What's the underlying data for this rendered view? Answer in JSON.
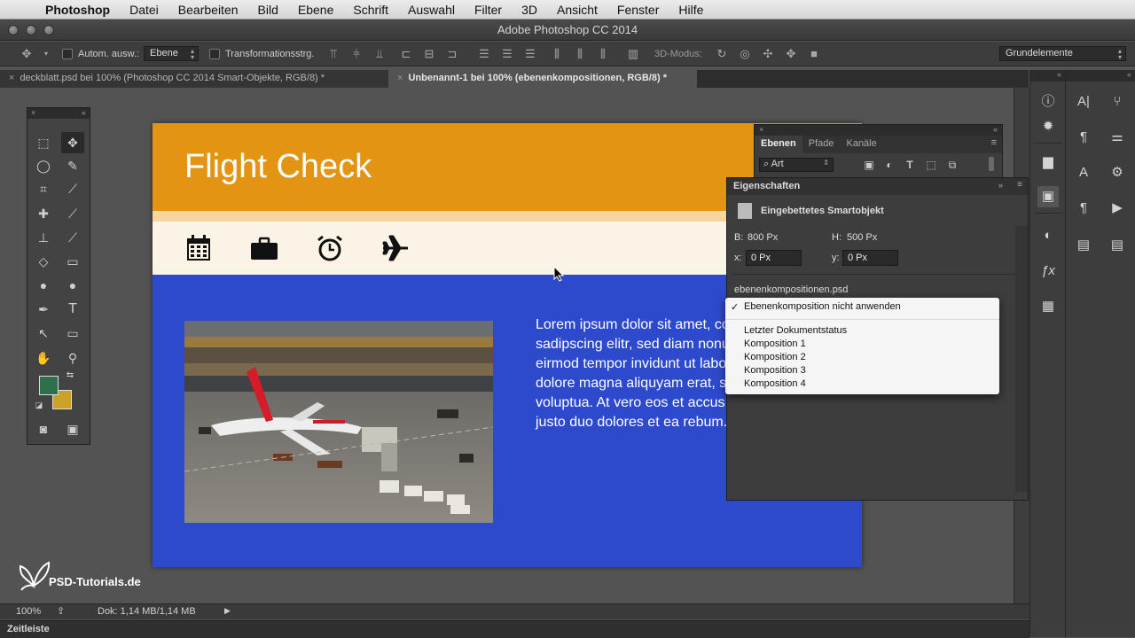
{
  "menubar": {
    "app_name": "Photoshop",
    "items": [
      "Datei",
      "Bearbeiten",
      "Bild",
      "Ebene",
      "Schrift",
      "Auswahl",
      "Filter",
      "3D",
      "Ansicht",
      "Fenster",
      "Hilfe"
    ]
  },
  "window": {
    "title": "Adobe Photoshop CC 2014"
  },
  "options_bar": {
    "auto_select_label": "Autom. ausw.:",
    "auto_select_value": "Ebene",
    "transform_label": "Transformationsstrg.",
    "mode_3d_label": "3D-Modus:",
    "workspace_value": "Grundelemente"
  },
  "tabs": [
    {
      "label": "deckblatt.psd bei 100% (Photoshop CC 2014  Smart-Objekte, RGB/8) *"
    },
    {
      "label": "Unbenannt-1 bei 100% (ebenenkompositionen, RGB/8) *"
    }
  ],
  "document": {
    "title": "Flight Check",
    "body_lines": [
      "Lorem ipsum dolor sit amet, co",
      "sadipscing elitr, sed diam nonu",
      "eirmod tempor invidunt ut labo",
      "dolore magna aliquyam erat, se",
      "voluptua. At vero eos et accus",
      "justo duo dolores et ea rebum."
    ],
    "colors": {
      "header": "#e29412",
      "body": "#2e4acc",
      "iconbar": "#fbf4e6"
    }
  },
  "layers_panel": {
    "tabs": [
      "Ebenen",
      "Pfade",
      "Kanäle"
    ],
    "filter_value": "Art"
  },
  "properties_panel": {
    "title": "Eigenschaften",
    "object_type": "Eingebettetes Smartobjekt",
    "w_label": "B:",
    "w_value": "800 Px",
    "h_label": "H:",
    "h_value": "500 Px",
    "x_label": "x:",
    "x_value": "0 Px",
    "y_label": "y:",
    "y_value": "0 Px",
    "file_name": "ebenenkompositionen.psd"
  },
  "comp_dropdown": {
    "checked_item": "Ebenenkomposition nicht anwenden",
    "check_mark": "✓",
    "items": [
      "Letzter Dokumentstatus",
      "Komposition 1",
      "Komposition 2",
      "Komposition 3",
      "Komposition 4"
    ]
  },
  "status_bar": {
    "zoom": "100%",
    "doc_info": "Dok: 1,14 MB/1,14 MB"
  },
  "timeline": {
    "label": "Zeitleiste"
  },
  "watermark": {
    "text": "PSD-Tutorials.de"
  }
}
